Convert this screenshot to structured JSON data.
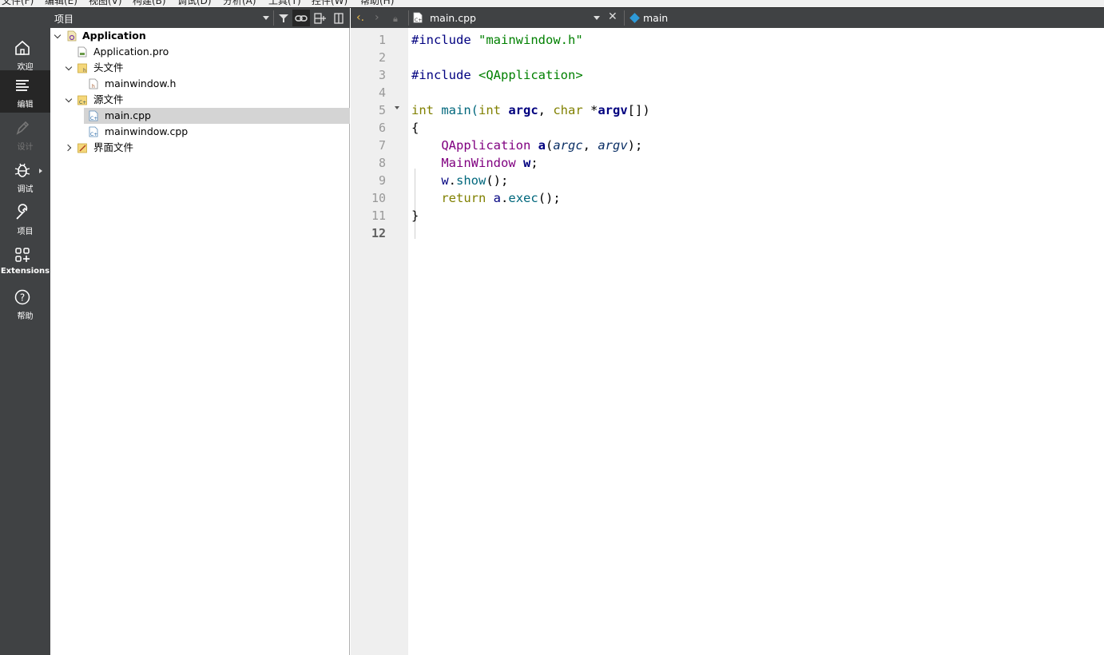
{
  "menu": [
    "文件(F)",
    "编辑(E)",
    "视图(V)",
    "构建(B)",
    "调试(D)",
    "分析(A)",
    "工具(T)",
    "控件(W)",
    "帮助(H)"
  ],
  "modes": [
    {
      "label": "欢迎",
      "icon": "home-icon",
      "state": "normal"
    },
    {
      "label": "编辑",
      "icon": "edit-icon",
      "state": "active"
    },
    {
      "label": "设计",
      "icon": "design-pen-icon",
      "state": "disabled"
    },
    {
      "label": "调试",
      "icon": "debug-bug-icon",
      "state": "normal"
    },
    {
      "label": "项目",
      "icon": "wrench-icon",
      "state": "normal"
    },
    {
      "label": "Extensions",
      "icon": "extensions-icon",
      "state": "normal"
    },
    {
      "label": "帮助",
      "icon": "help-icon",
      "state": "normal"
    }
  ],
  "project_panel": {
    "title": "项目",
    "tools": [
      "filter-icon",
      "link-icon",
      "split-icon",
      "close-panel-icon"
    ],
    "tree": [
      {
        "label": "Application",
        "level": 0,
        "expanded": true,
        "kind": "project",
        "bold": true
      },
      {
        "label": "Application.pro",
        "level": 1,
        "kind": "pro-file"
      },
      {
        "label": "头文件",
        "level": 1,
        "expanded": true,
        "kind": "header-folder"
      },
      {
        "label": "mainwindow.h",
        "level": 2,
        "kind": "header-file"
      },
      {
        "label": "源文件",
        "level": 1,
        "expanded": true,
        "kind": "source-folder"
      },
      {
        "label": "main.cpp",
        "level": 2,
        "kind": "cpp-file",
        "selected": true
      },
      {
        "label": "mainwindow.cpp",
        "level": 2,
        "kind": "cpp-file"
      },
      {
        "label": "界面文件",
        "level": 1,
        "expanded": false,
        "kind": "form-folder"
      }
    ]
  },
  "editor": {
    "document": "main.cpp",
    "symbol": "main",
    "current_line": 12,
    "line_numbers": [
      "1",
      "2",
      "3",
      "4",
      "5",
      "6",
      "7",
      "8",
      "9",
      "10",
      "11",
      "12"
    ]
  },
  "colors": {
    "sidebar_bg": "#404244",
    "sidebar_active": "#262626",
    "selection_bg": "#d4d4d4",
    "gutter_bg": "#efefef"
  }
}
